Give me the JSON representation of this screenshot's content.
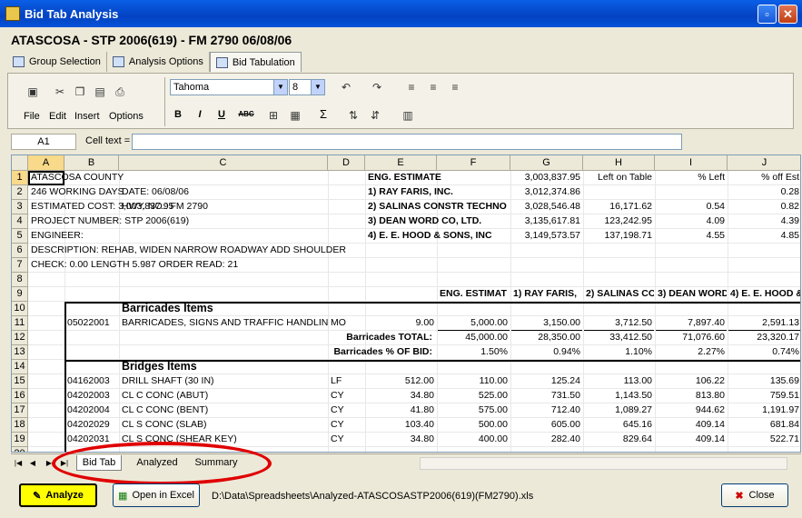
{
  "window": {
    "title": "Bid Tab Analysis",
    "doc_title": "ATASCOSA - STP 2006(619) - FM 2790 06/08/06"
  },
  "tabs": [
    {
      "label": "Group Selection"
    },
    {
      "label": "Analysis Options"
    },
    {
      "label": "Bid Tabulation"
    }
  ],
  "toolbar": {
    "font": "Tahoma",
    "size": "8",
    "menus": [
      "File",
      "Edit",
      "Insert",
      "Options"
    ],
    "bold": "B",
    "italic": "I",
    "underline": "U",
    "strike": "ABC",
    "sigma": "Σ"
  },
  "cellbar": {
    "name": "A1",
    "label": "Cell text ="
  },
  "columns": [
    "A",
    "B",
    "C",
    "D",
    "E",
    "F",
    "G",
    "H",
    "I",
    "J"
  ],
  "rows": [
    "1",
    "2",
    "3",
    "4",
    "5",
    "6",
    "7",
    "8",
    "9",
    "10",
    "11",
    "12",
    "13",
    "14",
    "15",
    "16",
    "17",
    "18",
    "19",
    "20"
  ],
  "cells": {
    "r1a": "ATASCOSA COUNTY",
    "r1e": "ENG. ESTIMATE",
    "r1g": "3,003,837.95",
    "r1h": "Left on Table",
    "r1i": "% Left",
    "r1j": "% off Est",
    "r2a": "246 WORKING DAYS",
    "r2c": "DATE: 06/08/06",
    "r2e": "1) RAY FARIS, INC.",
    "r2g": "3,012,374.86",
    "r2j": "0.28",
    "r3a": "ESTIMATED COST:   3,003,837.95",
    "r3c": "HWY. NO.: FM 2790",
    "r3e": "2) SALINAS CONSTR TECHNO",
    "r3g": "3,028,546.48",
    "r3h": "16,171.62",
    "r3i": "0.54",
    "r3j": "0.82",
    "r4a": "PROJECT NUMBER: STP 2006(619)",
    "r4e": "3) DEAN WORD CO, LTD.",
    "r4g": "3,135,617.81",
    "r4h": "123,242.95",
    "r4i": "4.09",
    "r4j": "4.39",
    "r5a": "ENGINEER:",
    "r5e": "4) E. E. HOOD & SONS, INC",
    "r5g": "3,149,573.57",
    "r5h": "137,198.71",
    "r5i": "4.55",
    "r5j": "4.85",
    "r6a": "DESCRIPTION: REHAB, WIDEN NARROW ROADWAY ADD SHOULDER",
    "r7a": "CHECK:     0.00   LENGTH     5.987    ORDER READ: 21",
    "r9f": "ENG. ESTIMAT",
    "r9g": "1) RAY FARIS,",
    "r9h": "2) SALINAS CO",
    "r9i": "3) DEAN WORD",
    "r9j": "4) E. E. HOOD &",
    "r10c": "Barricades Items",
    "r11b": "05022001",
    "r11c": "BARRICADES, SIGNS AND TRAFFIC HANDLING",
    "r11d": "MO",
    "r11e": "9.00",
    "r11f": "5,000.00",
    "r11g": "3,150.00",
    "r11h": "3,712.50",
    "r11i": "7,897.40",
    "r11j": "2,591.13",
    "r12e": "Barricades TOTAL:",
    "r12f": "45,000.00",
    "r12g": "28,350.00",
    "r12h": "33,412.50",
    "r12i": "71,076.60",
    "r12j": "23,320.17",
    "r13e": "Barricades % OF BID:",
    "r13f": "1.50%",
    "r13g": "0.94%",
    "r13h": "1.10%",
    "r13i": "2.27%",
    "r13j": "0.74%",
    "r14c": "Bridges Items",
    "r15b": "04162003",
    "r15c": "DRILL SHAFT (30 IN)",
    "r15d": "LF",
    "r15e": "512.00",
    "r15f": "110.00",
    "r15g": "125.24",
    "r15h": "113.00",
    "r15i": "106.22",
    "r15j": "135.69",
    "r16b": "04202003",
    "r16c": "CL C CONC (ABUT)",
    "r16d": "CY",
    "r16e": "34.80",
    "r16f": "525.00",
    "r16g": "731.50",
    "r16h": "1,143.50",
    "r16i": "813.80",
    "r16j": "759.51",
    "r17b": "04202004",
    "r17c": "CL C CONC (BENT)",
    "r17d": "CY",
    "r17e": "41.80",
    "r17f": "575.00",
    "r17g": "712.40",
    "r17h": "1,089.27",
    "r17i": "944.62",
    "r17j": "1,191.97",
    "r18b": "04202029",
    "r18c": "CL S CONC (SLAB)",
    "r18d": "CY",
    "r18e": "103.40",
    "r18f": "500.00",
    "r18g": "605.00",
    "r18h": "645.16",
    "r18i": "409.14",
    "r18j": "681.84",
    "r19b": "04202031",
    "r19c": "CL S CONC (SHEAR KEY)",
    "r19d": "CY",
    "r19e": "34.80",
    "r19f": "400.00",
    "r19g": "282.40",
    "r19h": "829.64",
    "r19i": "409.14",
    "r19j": "522.71"
  },
  "sheets": [
    "Bid Tab",
    "Analyzed",
    "Summary"
  ],
  "bottom": {
    "analyze": "Analyze",
    "open_excel": "Open in Excel",
    "path": "D:\\Data\\Spreadsheets\\Analyzed-ATASCOSASTP2006(619)(FM2790).xls",
    "close": "Close"
  },
  "colors": {
    "title_bar": "#0553d8",
    "highlight": "#ffff00",
    "annotation": "#e00000"
  }
}
